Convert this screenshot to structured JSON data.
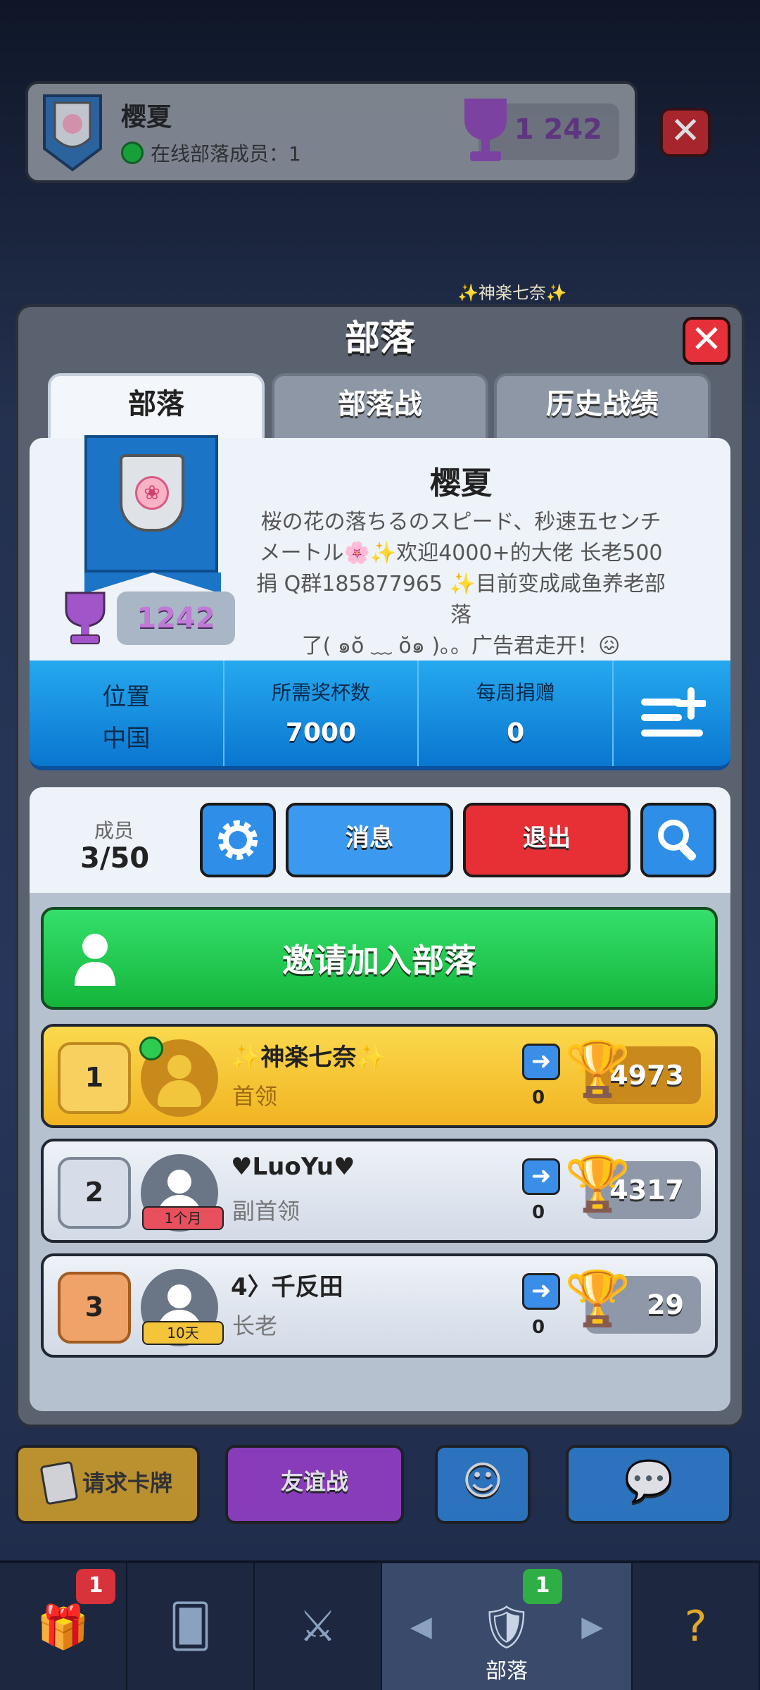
{
  "top_card": {
    "clan_name": "樱夏",
    "online_text": "在线部落成员：1",
    "trophies": "1 242"
  },
  "floating_name": "✨神楽七奈✨",
  "panel": {
    "title": "部落",
    "tabs": [
      "部落",
      "部落战",
      "历史战绩"
    ]
  },
  "clan": {
    "trophies": "1242",
    "name": "樱夏",
    "description_lines": [
      "桜の花の落ちるのスピード、秒速五センチ",
      "メートル🌸✨欢迎4000+的大佬 长老500",
      "捐 Q群185877965 ✨目前变成咸鱼养老部落",
      "了( ๑ŏ ﹏ ŏ๑ )。。广告君走开！😖"
    ]
  },
  "stats": {
    "location_label": "位置",
    "location_value": "中国",
    "required_label": "所需奖杯数",
    "required_value": "7000",
    "donation_label": "每周捐赠",
    "donation_value": "0"
  },
  "members": {
    "label": "成员",
    "count": "3/50",
    "message_button": "消息",
    "exit_button": "退出",
    "invite_button": "邀请加入部落"
  },
  "member_list": [
    {
      "rank": "1",
      "name": "✨神楽七奈✨",
      "role": "首领",
      "donated": "0",
      "trophies": "4973",
      "tag": ""
    },
    {
      "rank": "2",
      "name": "♥LuoYu♥",
      "role": "副首领",
      "donated": "0",
      "trophies": "4317",
      "tag": "1个月"
    },
    {
      "rank": "3",
      "name": "4〉千反田",
      "role": "长老",
      "donated": "0",
      "trophies": "29",
      "tag": "10天"
    }
  ],
  "actions": {
    "request": "请求卡牌",
    "friendly": "友谊战"
  },
  "nav": {
    "chest_badge": "1",
    "clan_badge": "1",
    "clan_label": "部落"
  },
  "colors": {
    "accent_blue": "#0a76d0",
    "green": "#15b53b",
    "red": "#e73036",
    "gold": "#f1b422"
  }
}
